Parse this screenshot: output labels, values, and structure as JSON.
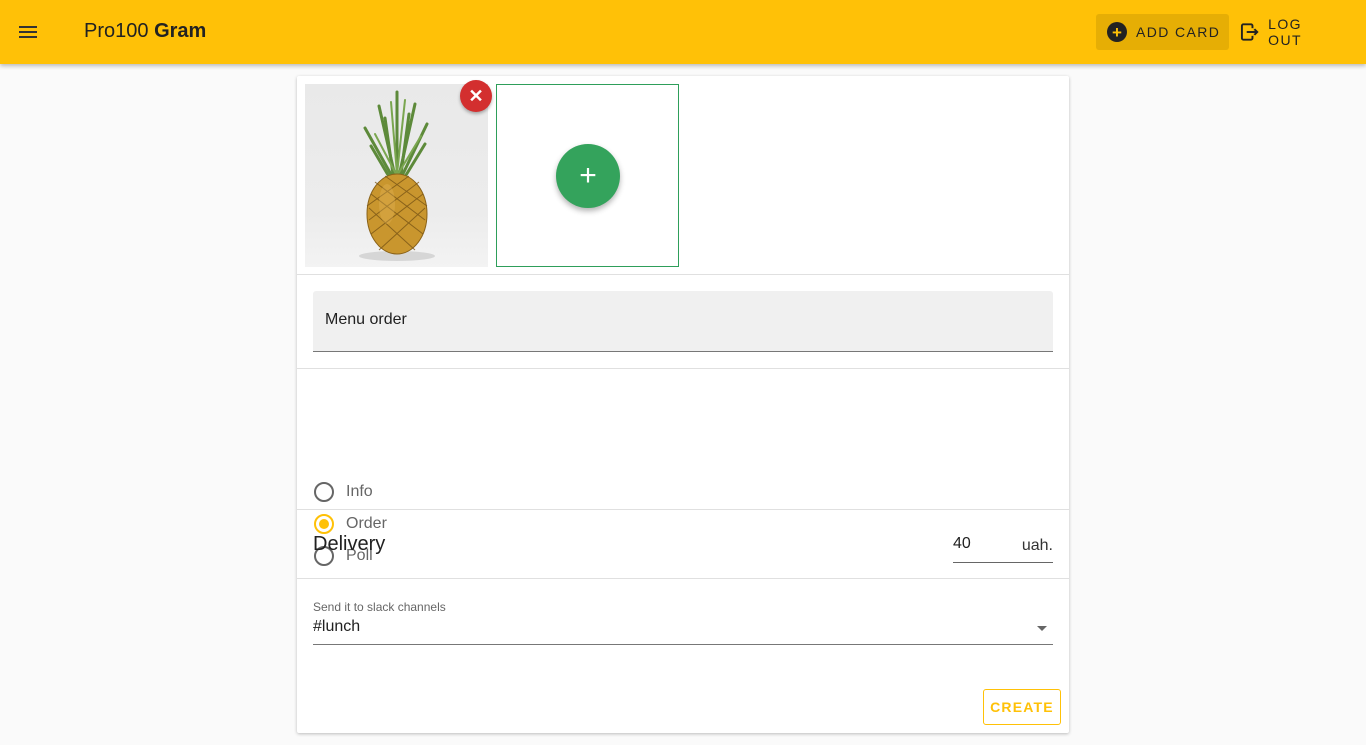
{
  "header": {
    "brand_light": "Pro100",
    "brand_bold": "Gram",
    "add_card_label": "ADD CARD",
    "logout_label": "LOG OUT",
    "accent_color": "#ffc107"
  },
  "form": {
    "images": [
      {
        "alt": "pineapple-photo",
        "removable": true
      }
    ],
    "add_image_icon": "plus-icon",
    "title_value": "Menu order",
    "type_options": [
      {
        "label": "Info",
        "checked": false
      },
      {
        "label": "Order",
        "checked": true
      },
      {
        "label": "Poll",
        "checked": false
      }
    ],
    "delivery": {
      "label": "Delivery",
      "value": "40",
      "suffix": "uah."
    },
    "channels": {
      "label": "Send it to slack channels",
      "selected": "#lunch"
    },
    "create_label": "CREATE"
  }
}
